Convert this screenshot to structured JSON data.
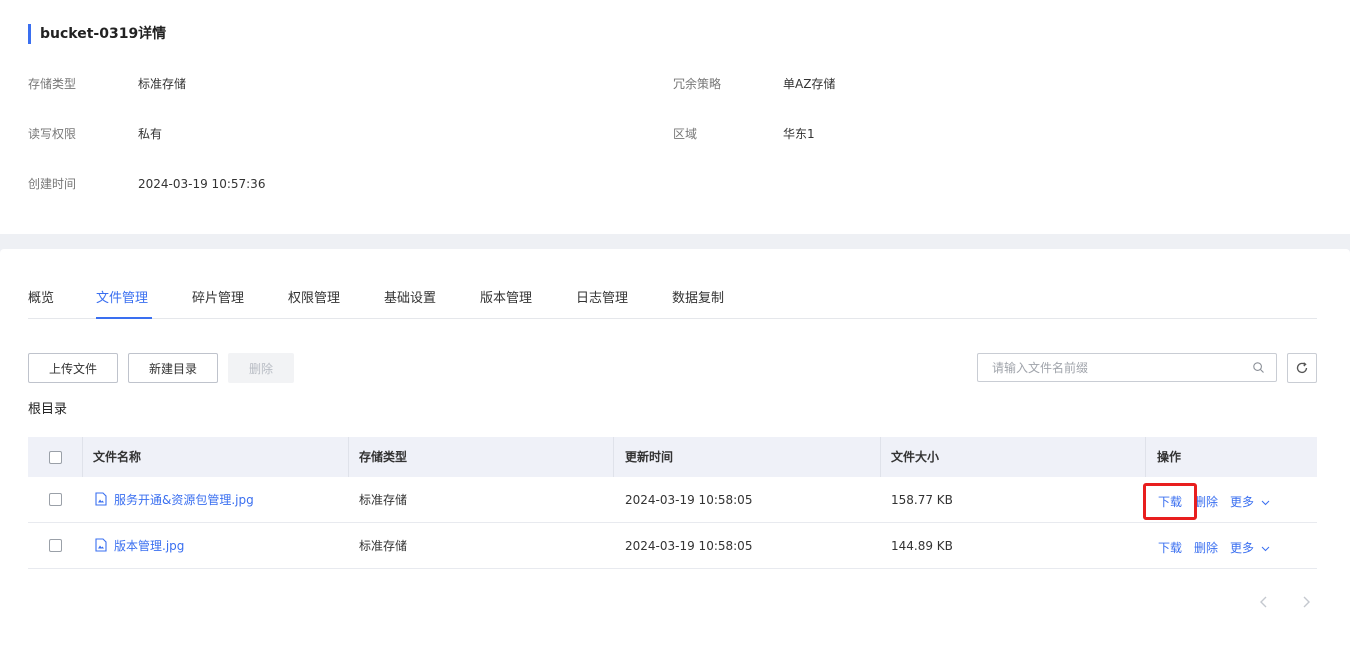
{
  "bucket": {
    "title": "bucket-0319详情",
    "fields": [
      {
        "label": "存储类型",
        "value": "标准存储"
      },
      {
        "label": "冗余策略",
        "value": "单AZ存储"
      },
      {
        "label": "读写权限",
        "value": "私有"
      },
      {
        "label": "区域",
        "value": "华东1"
      },
      {
        "label": "创建时间",
        "value": "2024-03-19 10:57:36"
      }
    ]
  },
  "tabs": [
    "概览",
    "文件管理",
    "碎片管理",
    "权限管理",
    "基础设置",
    "版本管理",
    "日志管理",
    "数据复制"
  ],
  "active_tab": "文件管理",
  "toolbar": {
    "upload_label": "上传文件",
    "new_dir_label": "新建目录",
    "delete_label": "删除"
  },
  "search": {
    "placeholder": "请输入文件名前缀",
    "value": ""
  },
  "breadcrumb": "根目录",
  "table": {
    "columns": [
      "文件名称",
      "存储类型",
      "更新时间",
      "文件大小",
      "操作"
    ],
    "rows": [
      {
        "name": "服务开通&资源包管理.jpg",
        "storage": "标准存储",
        "updated": "2024-03-19 10:58:05",
        "size": "158.77 KB"
      },
      {
        "name": "版本管理.jpg",
        "storage": "标准存储",
        "updated": "2024-03-19 10:58:05",
        "size": "144.89 KB"
      }
    ],
    "actions": {
      "download": "下载",
      "delete": "删除",
      "more": "更多"
    }
  },
  "colors": {
    "accent": "#3a6ff0",
    "highlight": "#e81e1e"
  }
}
